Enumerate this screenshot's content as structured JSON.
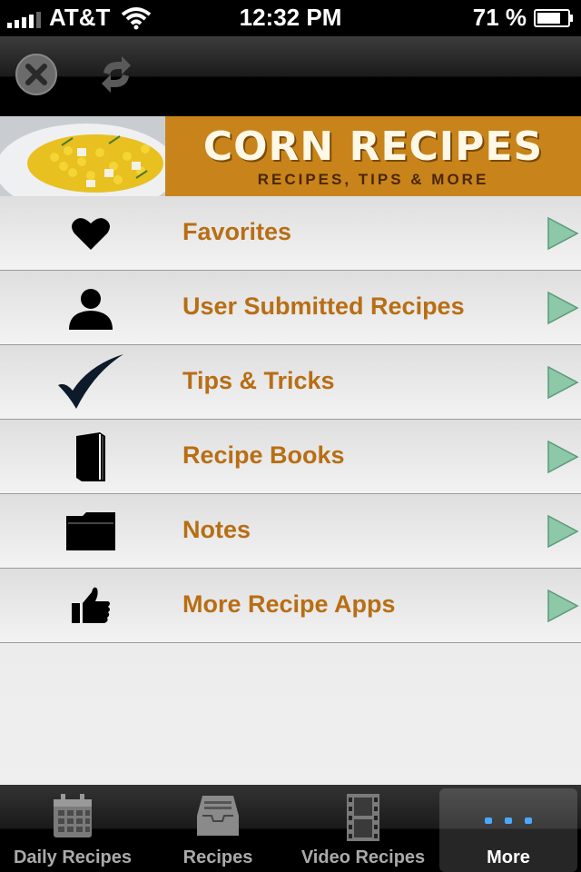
{
  "status_bar": {
    "carrier": "AT&T",
    "time": "12:32 PM",
    "battery": "71 %"
  },
  "toolbar": {
    "close_icon": "close-circle-icon",
    "refresh_icon": "refresh-icon"
  },
  "banner": {
    "title": "CORN RECIPES",
    "subtitle": "RECIPES, TIPS & MORE"
  },
  "menu": {
    "items": [
      {
        "label": "Favorites",
        "icon": "heart-icon"
      },
      {
        "label": "User Submitted Recipes",
        "icon": "user-icon"
      },
      {
        "label": "Tips & Tricks",
        "icon": "checkmark-icon"
      },
      {
        "label": "Recipe Books",
        "icon": "book-icon"
      },
      {
        "label": "Notes",
        "icon": "folder-icon"
      },
      {
        "label": "More Recipe Apps",
        "icon": "thumbs-up-icon"
      }
    ]
  },
  "tabbar": {
    "tabs": [
      {
        "label": "Daily Recipes",
        "icon": "calendar-icon"
      },
      {
        "label": "Recipes",
        "icon": "inbox-tray-icon"
      },
      {
        "label": "Video Recipes",
        "icon": "film-strip-icon"
      },
      {
        "label": "More",
        "icon": "more-dots-icon",
        "active": true
      }
    ]
  },
  "colors": {
    "accent_label": "#b86e14",
    "banner_bg": "#c8841a",
    "arrow": "#7fc0a0"
  }
}
